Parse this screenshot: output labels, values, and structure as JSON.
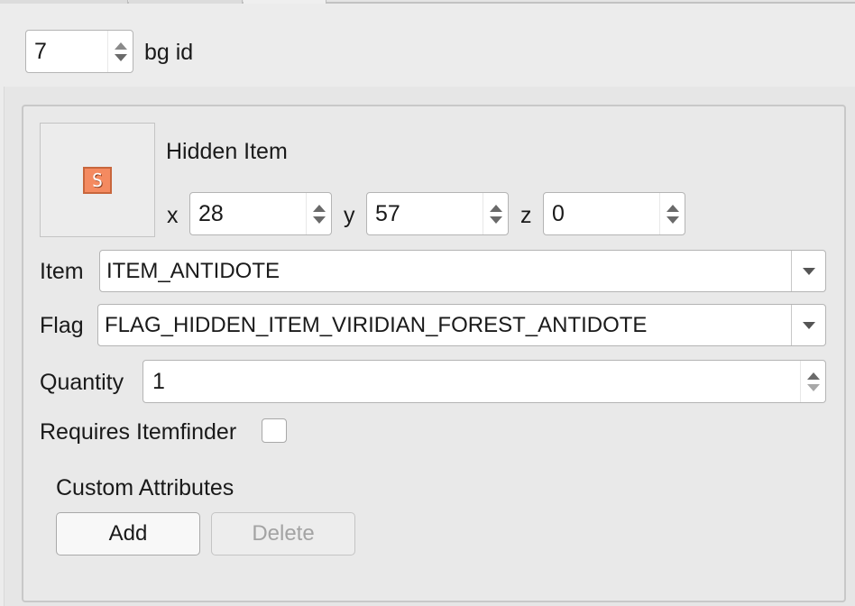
{
  "header": {
    "bg_id_value": "7",
    "bg_id_label": "bg id"
  },
  "event": {
    "type_label": "Hidden Item",
    "sprite_glyph": "S",
    "sprite_color": "#f48a60",
    "coords": {
      "x_label": "x",
      "x_value": "28",
      "y_label": "y",
      "y_value": "57",
      "z_label": "z",
      "z_value": "0"
    }
  },
  "fields": {
    "item_label": "Item",
    "item_value": "ITEM_ANTIDOTE",
    "flag_label": "Flag",
    "flag_value": "FLAG_HIDDEN_ITEM_VIRIDIAN_FOREST_ANTIDOTE",
    "quantity_label": "Quantity",
    "quantity_value": "1",
    "itemfinder_label": "Requires Itemfinder",
    "itemfinder_checked": false
  },
  "custom_attributes": {
    "title": "Custom Attributes",
    "add_label": "Add",
    "delete_label": "Delete"
  }
}
